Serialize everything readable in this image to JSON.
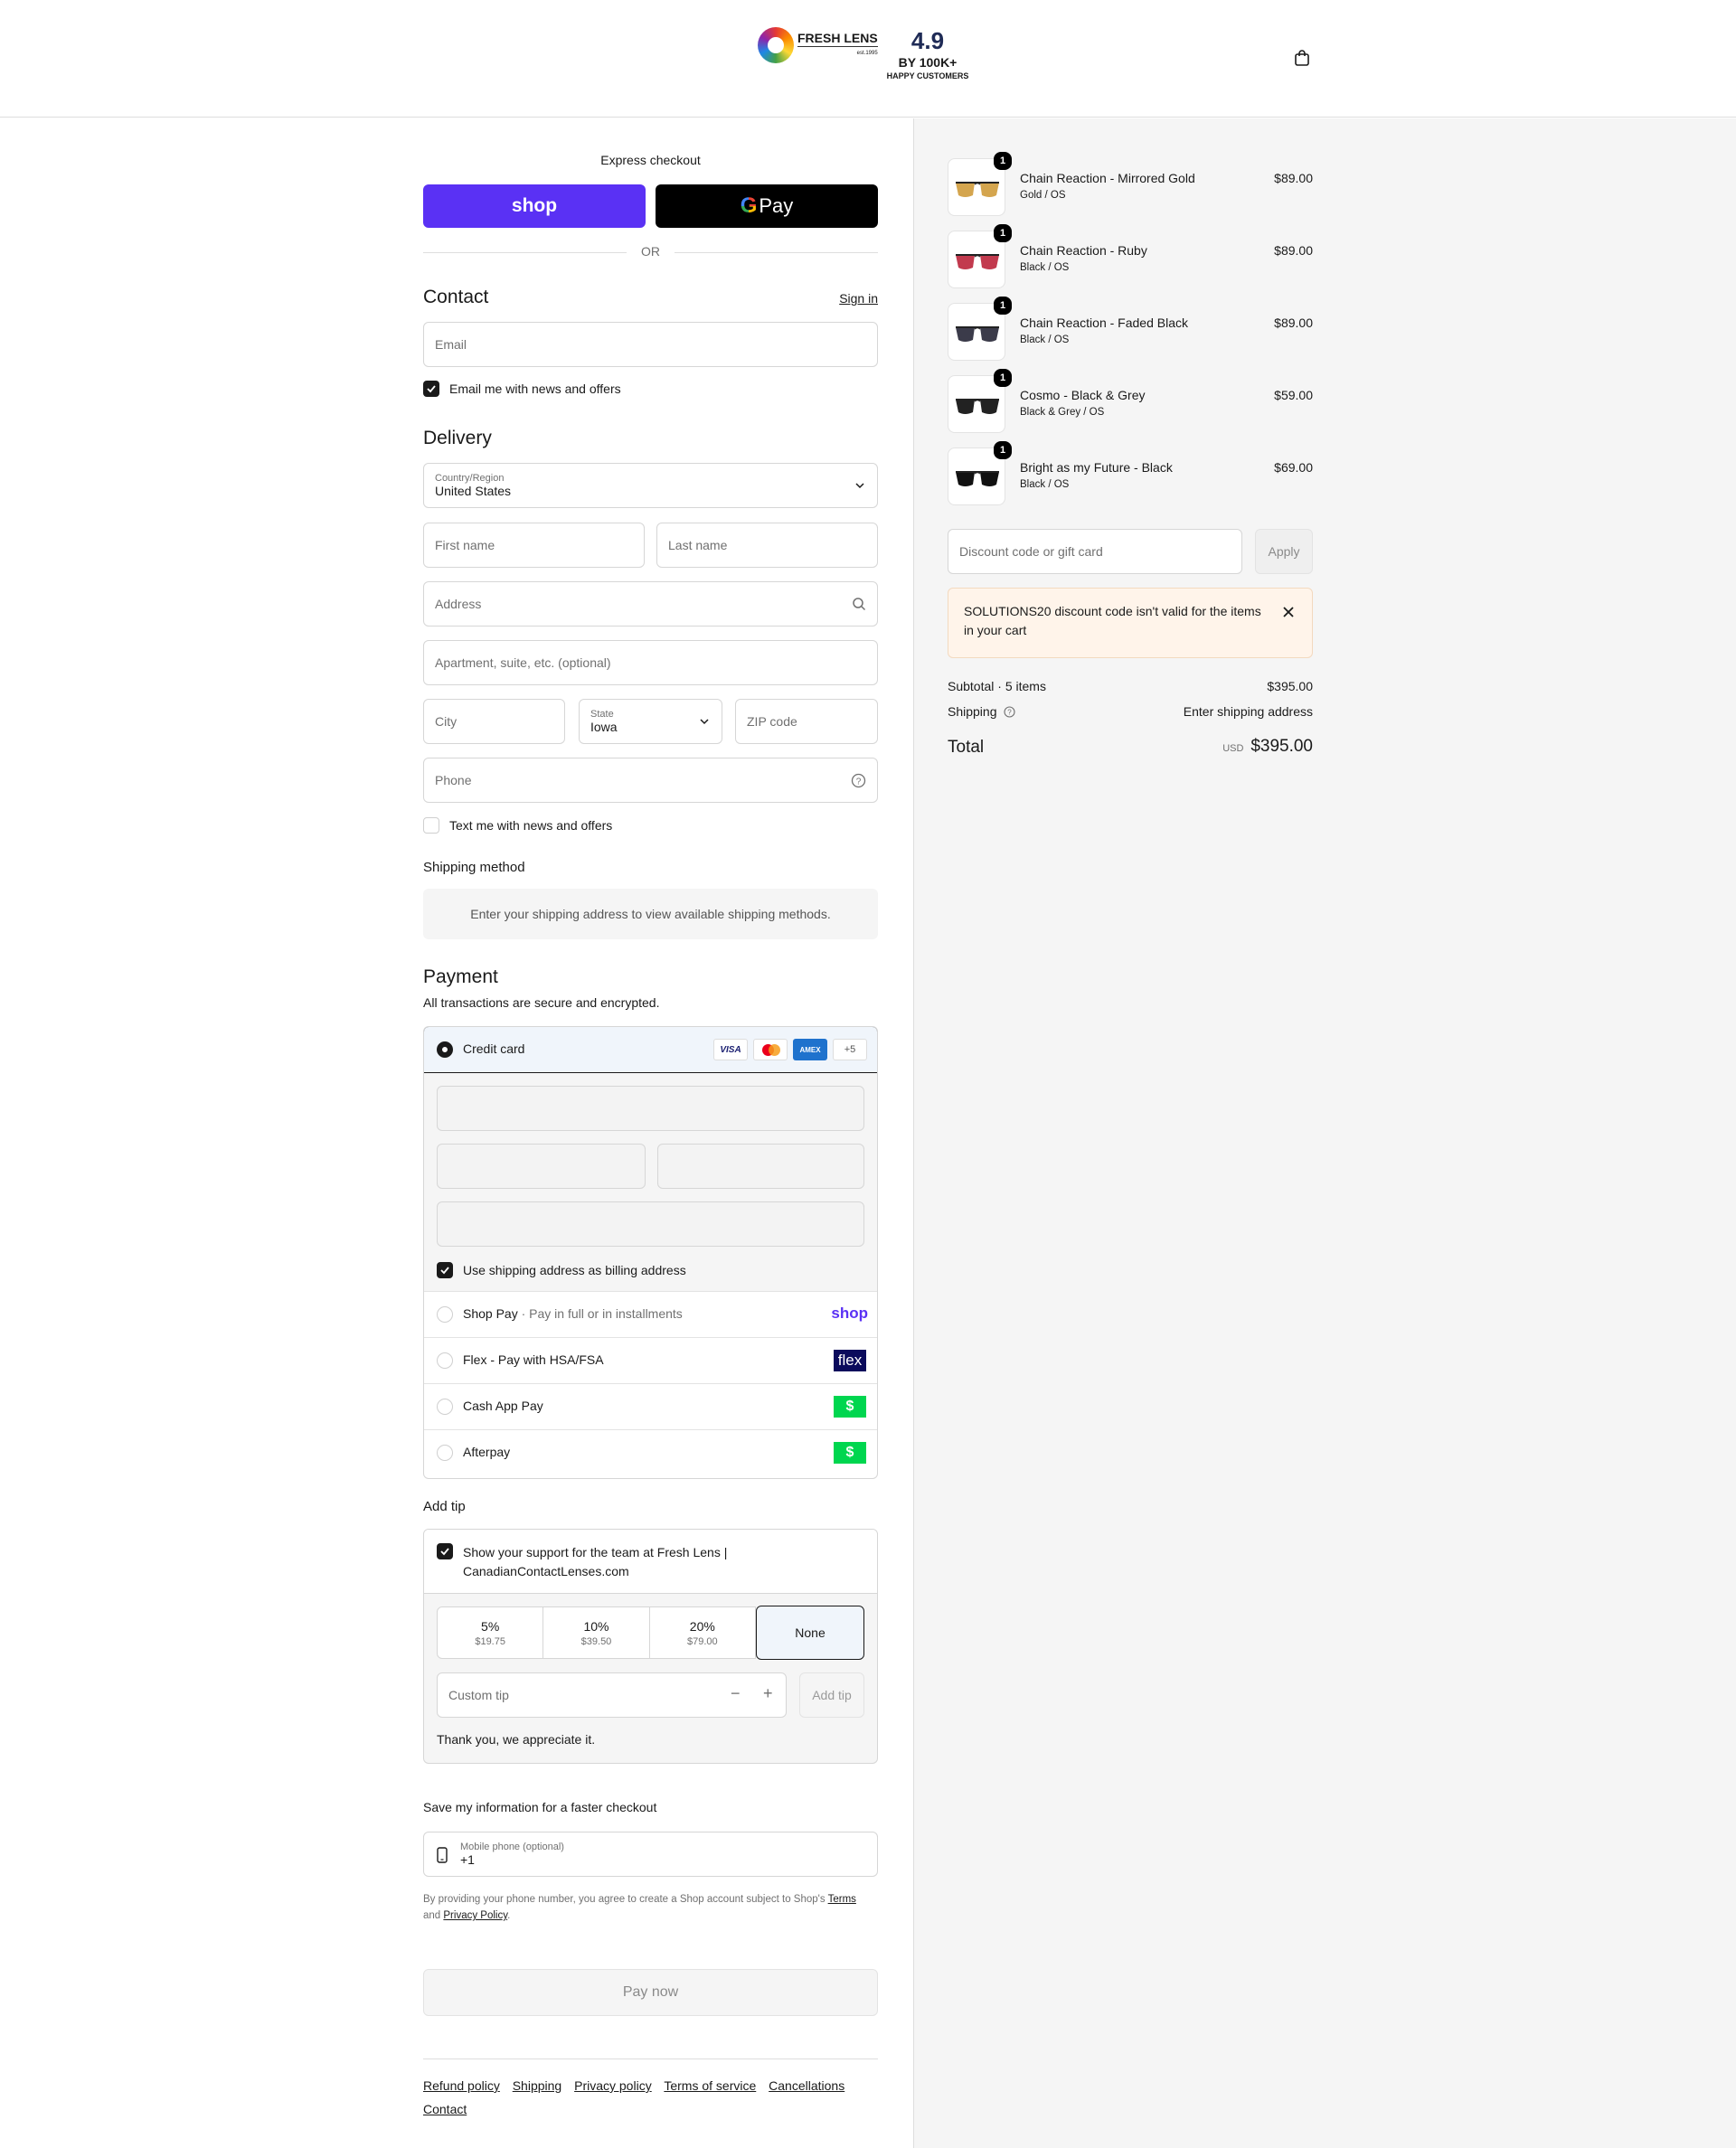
{
  "header": {
    "logo_text": "FRESH LENS",
    "logo_sub": "est.1995",
    "rating_score": "4.9",
    "rating_by": "BY 100K+",
    "rating_customers": "HAPPY CUSTOMERS"
  },
  "express": {
    "title": "Express checkout",
    "shop_label": "shop",
    "gpay_label": "Pay",
    "or": "OR"
  },
  "contact": {
    "title": "Contact",
    "sign_in": "Sign in",
    "email_placeholder": "Email",
    "news_label": "Email me with news and offers"
  },
  "delivery": {
    "title": "Delivery",
    "country_label": "Country/Region",
    "country_value": "United States",
    "first_name": "First name",
    "last_name": "Last name",
    "address": "Address",
    "apartment": "Apartment, suite, etc. (optional)",
    "city": "City",
    "state_label": "State",
    "state_value": "Iowa",
    "zip": "ZIP code",
    "phone": "Phone",
    "text_offers": "Text me with news and offers"
  },
  "shipping_method": {
    "title": "Shipping method",
    "message": "Enter your shipping address to view available shipping methods."
  },
  "payment": {
    "title": "Payment",
    "subtitle": "All transactions are secure and encrypted.",
    "credit_card": "Credit card",
    "card_visa": "VISA",
    "card_amex": "AMEX",
    "card_more": "+5",
    "billing_same": "Use shipping address as billing address",
    "methods": [
      {
        "label": "Shop Pay",
        "sub": "Pay in full or in installments",
        "logo": "shop"
      },
      {
        "label": "Flex - Pay with HSA/FSA",
        "sub": "",
        "logo": "flex"
      },
      {
        "label": "Cash App Pay",
        "sub": "",
        "logo": "$"
      },
      {
        "label": "Afterpay",
        "sub": "",
        "logo": "$"
      }
    ]
  },
  "tip": {
    "title": "Add tip",
    "support_line1": "Show your support for the team at Fresh Lens |",
    "support_line2": "CanadianContactLenses.com",
    "options": [
      {
        "pct": "5%",
        "amount": "$19.75"
      },
      {
        "pct": "10%",
        "amount": "$39.50"
      },
      {
        "pct": "20%",
        "amount": "$79.00"
      }
    ],
    "none": "None",
    "custom_placeholder": "Custom tip",
    "minus": "−",
    "plus": "+",
    "add_tip": "Add tip",
    "thanks": "Thank you, we appreciate it."
  },
  "save_info": {
    "title": "Save my information for a faster checkout",
    "phone_label": "Mobile phone (optional)",
    "phone_value": "+1",
    "disclaimer_1": "By providing your phone number, you agree to create a Shop account subject to Shop's",
    "terms": "Terms",
    "and": "and",
    "privacy": "Privacy Policy",
    "period": "."
  },
  "pay_now": "Pay now",
  "footer_links": [
    "Refund policy",
    "Shipping",
    "Privacy policy",
    "Terms of service",
    "Cancellations",
    "Contact"
  ],
  "summary": {
    "items": [
      {
        "name": "Chain Reaction - Mirrored Gold",
        "variant": "Gold / OS",
        "price": "$89.00",
        "qty": "1",
        "lens": "#d4a54e"
      },
      {
        "name": "Chain Reaction - Ruby",
        "variant": "Black / OS",
        "price": "$89.00",
        "qty": "1",
        "lens": "#c23a4e"
      },
      {
        "name": "Chain Reaction - Faded Black",
        "variant": "Black / OS",
        "price": "$89.00",
        "qty": "1",
        "lens": "#3b3b4a"
      },
      {
        "name": "Cosmo - Black & Grey",
        "variant": "Black & Grey / OS",
        "price": "$59.00",
        "qty": "1",
        "lens": "#222"
      },
      {
        "name": "Bright as my Future - Black",
        "variant": "Black / OS",
        "price": "$69.00",
        "qty": "1",
        "lens": "#111"
      }
    ],
    "discount_placeholder": "Discount code or gift card",
    "apply": "Apply",
    "alert_line1": "SOLUTIONS20 discount code isn't valid for the items",
    "alert_line2": "in your cart",
    "subtotal_label": "Subtotal · 5 items",
    "subtotal_value": "$395.00",
    "shipping_label": "Shipping",
    "shipping_value": "Enter shipping address",
    "total_label": "Total",
    "currency": "USD",
    "total_value": "$395.00"
  },
  "colors": {
    "shop_purple": "#5a31f4",
    "alert_bg": "#fff4ea",
    "cash_green": "#00d64f",
    "flex_navy": "#0b0b5c"
  }
}
